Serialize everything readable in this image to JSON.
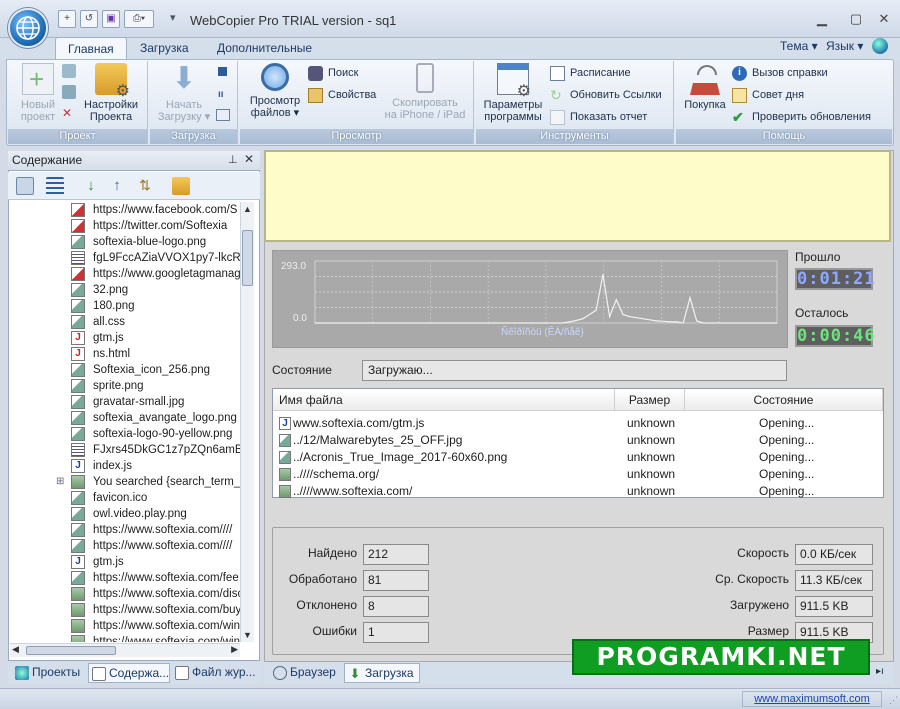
{
  "window": {
    "title": "WebCopier Pro TRIAL version - sq1",
    "minimize": "▁",
    "maximize": "▢",
    "close": "✕"
  },
  "quick_access": [
    "+",
    "↺",
    "💾",
    "🖨",
    "▾",
    "▾"
  ],
  "tabs": [
    {
      "label": "Главная"
    },
    {
      "label": "Загрузка"
    },
    {
      "label": "Дополнительные"
    }
  ],
  "top_right": {
    "theme": "Тема",
    "language": "Язык"
  },
  "groups": {
    "project": "Проект",
    "download": "Загрузка",
    "view": "Просмотр",
    "tools": "Инструменты",
    "help": "Помощь"
  },
  "buttons": {
    "new_project": "Новый\nпроект",
    "project_settings": "Настройки\nПроекта",
    "start_download": "Начать\nЗагрузку ▾",
    "browse_files": "Просмотр\nфайлов ▾",
    "search": "Поиск",
    "properties": "Свойства",
    "copy_iphone": "Скопировать\nна iPhone / iPad",
    "program_params": "Параметры\nпрограммы",
    "schedule": "Расписание",
    "update_links": "Обновить Ссылки",
    "show_report": "Показать отчет",
    "purchase": "Покупка",
    "call_help": "Вызов справки",
    "tip_of_day": "Совет дня",
    "check_updates": "Проверить обновления"
  },
  "left_pane": {
    "title": "Содержание",
    "tree": [
      {
        "text": "https://www.facebook.com/S",
        "icon": "link"
      },
      {
        "text": "https://twitter.com/Softexia",
        "icon": "link"
      },
      {
        "text": "softexia-blue-logo.png",
        "icon": "image"
      },
      {
        "text": "fgL9FccAZiaVVOX1py7-lkcR4",
        "icon": "doc"
      },
      {
        "text": "https://www.googletagmanage",
        "icon": "link"
      },
      {
        "text": "32.png",
        "icon": "image"
      },
      {
        "text": "180.png",
        "icon": "image"
      },
      {
        "text": "all.css",
        "icon": "image"
      },
      {
        "text": "gtm.js",
        "icon": "js-red"
      },
      {
        "text": "ns.html",
        "icon": "js-red"
      },
      {
        "text": "Softexia_icon_256.png",
        "icon": "image"
      },
      {
        "text": "sprite.png",
        "icon": "image"
      },
      {
        "text": "gravatar-small.jpg",
        "icon": "image"
      },
      {
        "text": "softexia_avangate_logo.png",
        "icon": "image"
      },
      {
        "text": "softexia-logo-90-yellow.png",
        "icon": "image"
      },
      {
        "text": "FJxrs45DkGC1z7pZQn6amB",
        "icon": "doc"
      },
      {
        "text": "index.js",
        "icon": "js"
      },
      {
        "text": "You searched {search_term_st",
        "icon": "folder"
      },
      {
        "text": "favicon.ico",
        "icon": "image"
      },
      {
        "text": "owl.video.play.png",
        "icon": "image"
      },
      {
        "text": "https://www.softexia.com////",
        "icon": "image"
      },
      {
        "text": "https://www.softexia.com////",
        "icon": "image"
      },
      {
        "text": "gtm.js",
        "icon": "js"
      },
      {
        "text": "https://www.softexia.com/fee",
        "icon": "image"
      },
      {
        "text": "https://www.softexia.com/disc",
        "icon": "folder"
      },
      {
        "text": "https://www.softexia.com/buy",
        "icon": "folder"
      },
      {
        "text": "https://www.softexia.com/win",
        "icon": "folder"
      },
      {
        "text": "https://www.softexia.com/win",
        "icon": "folder"
      }
    ],
    "bottom_tabs": [
      "Проекты",
      "Содержа...",
      "Файл жур..."
    ]
  },
  "graph": {
    "y_max": "293.0",
    "y_min": "0.0",
    "x_label": "Ñêîðîñòü (ÊÁ/ñåê)"
  },
  "chart_data": {
    "type": "line",
    "ylim": [
      0,
      293
    ],
    "values": [
      0,
      0,
      0,
      0,
      0,
      0,
      0,
      0,
      0,
      0,
      0,
      0,
      0,
      0,
      0,
      0,
      0,
      0,
      0,
      0,
      0,
      0,
      0,
      0,
      0,
      0,
      0,
      0,
      0,
      0,
      0,
      0,
      0,
      0,
      0,
      0,
      0,
      0,
      5,
      12,
      20,
      40,
      60,
      230,
      30,
      110,
      40,
      30,
      25,
      20,
      15,
      10,
      8,
      5,
      5,
      0,
      120,
      10,
      0,
      0,
      0,
      0,
      0,
      0,
      0,
      0,
      0,
      0,
      0,
      0
    ]
  },
  "timers": {
    "elapsed_label": "Прошло",
    "elapsed": "0:01:21",
    "remaining_label": "Осталось",
    "remaining": "0:00:46"
  },
  "status": {
    "label": "Состояние",
    "value": "Загружаю..."
  },
  "downloads": {
    "headers": [
      "Имя файла",
      "Размер",
      "Состояние"
    ],
    "rows": [
      {
        "name": "www.softexia.com/gtm.js",
        "size": "unknown",
        "state": "Opening...",
        "icon": "js"
      },
      {
        "name": "../12/Malwarebytes_25_OFF.jpg",
        "size": "unknown",
        "state": "Opening...",
        "icon": "image"
      },
      {
        "name": "../Acronis_True_Image_2017-60x60.png",
        "size": "unknown",
        "state": "Opening...",
        "icon": "image"
      },
      {
        "name": "..////schema.org/",
        "size": "unknown",
        "state": "Opening...",
        "icon": "folder"
      },
      {
        "name": "..////www.softexia.com/",
        "size": "unknown",
        "state": "Opening...",
        "icon": "folder"
      }
    ]
  },
  "stats": {
    "found_label": "Найдено",
    "found": "212",
    "processed_label": "Обработано",
    "processed": "81",
    "rejected_label": "Отклонено",
    "rejected": "8",
    "errors_label": "Ошибки",
    "errors": "1",
    "speed_label": "Скорость",
    "speed": "0.0 КБ/сек",
    "avg_speed_label": "Ср. Скорость",
    "avg_speed": "11.3 КБ/сек",
    "loaded_label": "Загружено",
    "loaded": "911.5 KB",
    "size_label": "Размер",
    "size": "911.5 KB"
  },
  "right_tabs": [
    "Браузер",
    "Загрузка"
  ],
  "statusbar": {
    "link": "www.maximumsoft.com"
  },
  "watermark": "PROGRAMKI.NET"
}
